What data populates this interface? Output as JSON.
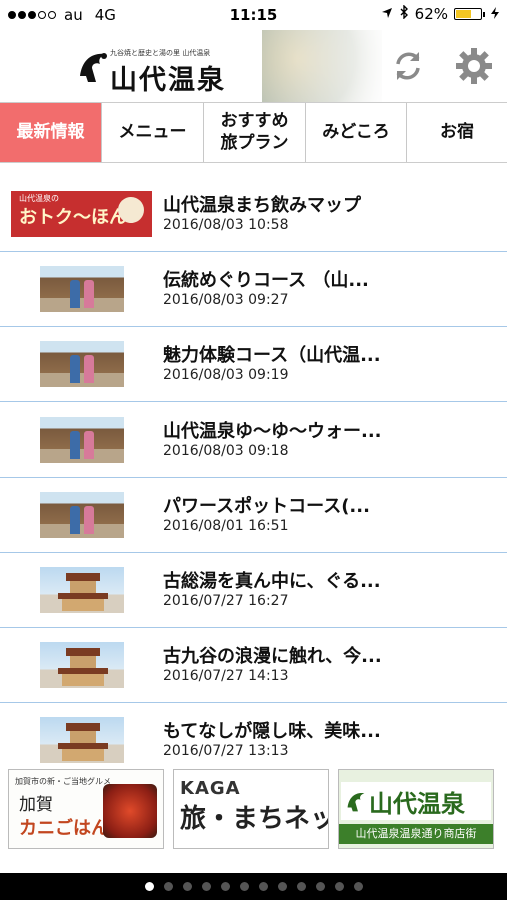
{
  "status_bar": {
    "carrier": "au",
    "network": "4G",
    "time": "11:15",
    "battery_label": "62%",
    "battery_level": 0.62,
    "signal_bars": 3,
    "signal_max": 5,
    "icons": [
      "location-arrow-icon",
      "bluetooth-icon",
      "battery-icon",
      "charging-icon"
    ]
  },
  "header": {
    "logo_tagline": "九谷焼と歴史と湯の里 山代温泉",
    "logo_text": "山代温泉",
    "refresh_icon": "refresh-icon",
    "settings_icon": "gear-icon"
  },
  "tabs": [
    {
      "label": "最新情報",
      "active": true
    },
    {
      "label": "メニュー",
      "active": false
    },
    {
      "label": "おすすめ\n旅プラン",
      "active": false
    },
    {
      "label": "みどころ",
      "active": false
    },
    {
      "label": "お宿",
      "active": false
    }
  ],
  "news": [
    {
      "title": "山代温泉まち飲みマップ",
      "date": "2016/08/03 10:58",
      "thumb": "banner",
      "thumb_text_small": "山代温泉の",
      "thumb_text_big": "おトク〜ほん!"
    },
    {
      "title": "伝統めぐりコース （山...",
      "date": "2016/08/03 09:27",
      "thumb": "street"
    },
    {
      "title": "魅力体験コース（山代温...",
      "date": "2016/08/03 09:19",
      "thumb": "street"
    },
    {
      "title": "山代温泉ゆ〜ゆ〜ウォー...",
      "date": "2016/08/03 09:18",
      "thumb": "street"
    },
    {
      "title": "パワースポットコース(...",
      "date": "2016/08/01 16:51",
      "thumb": "street"
    },
    {
      "title": "古総湯を真ん中に、ぐる...",
      "date": "2016/07/27 16:27",
      "thumb": "tower"
    },
    {
      "title": "古九谷の浪漫に触れ、今...",
      "date": "2016/07/27 14:13",
      "thumb": "tower"
    },
    {
      "title": "もてなしが隠し味、美味...",
      "date": "2016/07/27 13:13",
      "thumb": "tower"
    }
  ],
  "banners": [
    {
      "small": "加賀市の新・ご当地グルメ",
      "big": "加賀",
      "accent": "カニごはん"
    },
    {
      "top": "KAGA",
      "main": "旅・まちネット"
    },
    {
      "logo": "山代温泉",
      "sub": "山代温泉温泉通り商店街"
    }
  ],
  "pager": {
    "count": 12,
    "active_index": 0
  },
  "colors": {
    "active_tab": "#f26d6d",
    "row_divider": "#a6c8e8",
    "battery": "#f3c623",
    "banner_green": "#3c7f2a"
  }
}
